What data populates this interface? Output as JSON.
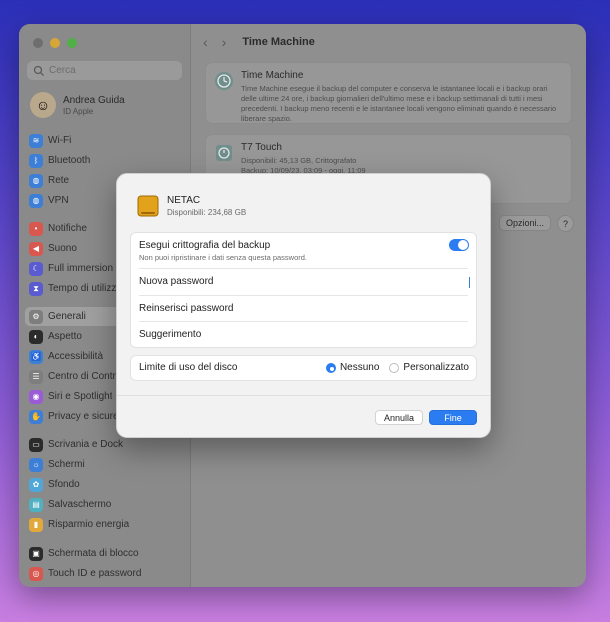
{
  "window": {
    "traffic_colors": [
      "#e14b43",
      "#e2a93a",
      "#56b847"
    ]
  },
  "sidebar": {
    "search_placeholder": "Cerca",
    "user": {
      "name": "Andrea Guida",
      "subtitle": "ID Apple"
    },
    "items": [
      {
        "label": "Wi-Fi",
        "icon": "wifi-icon",
        "color": "#3d7fd6"
      },
      {
        "label": "Bluetooth",
        "icon": "bluetooth-icon",
        "color": "#3d7fd6"
      },
      {
        "label": "Rete",
        "icon": "globe-icon",
        "color": "#3d7fd6"
      },
      {
        "label": "VPN",
        "icon": "vpn-icon",
        "color": "#3d7fd6"
      },
      {
        "label": "Notifiche",
        "icon": "bell-icon",
        "color": "#d8574e"
      },
      {
        "label": "Suono",
        "icon": "speaker-icon",
        "color": "#d8574e"
      },
      {
        "label": "Full immersion",
        "icon": "moon-icon",
        "color": "#5a5bd1"
      },
      {
        "label": "Tempo di utilizzo",
        "icon": "hourglass-icon",
        "color": "#5a5bd1"
      },
      {
        "label": "Generali",
        "icon": "gear-icon",
        "color": "#7e7e7e"
      },
      {
        "label": "Aspetto",
        "icon": "appearance-icon",
        "color": "#2b2b2b"
      },
      {
        "label": "Accessibilità",
        "icon": "accessibility-icon",
        "color": "#3d7fd6"
      },
      {
        "label": "Centro di Controllo",
        "icon": "control-center-icon",
        "color": "#7e7e7e"
      },
      {
        "label": "Siri e Spotlight",
        "icon": "siri-icon",
        "color": "#9b5bd6"
      },
      {
        "label": "Privacy e sicurezza",
        "icon": "hand-icon",
        "color": "#3d7fd6"
      },
      {
        "label": "Scrivania e Dock",
        "icon": "dock-icon",
        "color": "#2b2b2b"
      },
      {
        "label": "Schermi",
        "icon": "display-icon",
        "color": "#3d7fd6"
      },
      {
        "label": "Sfondo",
        "icon": "wallpaper-icon",
        "color": "#4fa6d8"
      },
      {
        "label": "Salvaschermo",
        "icon": "screensaver-icon",
        "color": "#4fb0c0"
      },
      {
        "label": "Risparmio energia",
        "icon": "battery-icon",
        "color": "#e2a93a"
      },
      {
        "label": "Schermata di blocco",
        "icon": "lock-screen-icon",
        "color": "#2b2b2b"
      },
      {
        "label": "Touch ID e password",
        "icon": "fingerprint-icon",
        "color": "#d8574e"
      }
    ]
  },
  "content": {
    "title": "Time Machine",
    "tm_card": {
      "title": "Time Machine",
      "description": "Time Machine esegue il backup del computer e conserva le istantanee locali e i backup orari delle ultime 24 ore, i backup giornalieri dell'ultimo mese e i backup settimanali di tutti i mesi precedenti. I backup meno recenti e le istantanee locali vengono eliminati quando è necessario liberare spazio."
    },
    "t7_card": {
      "title": "T7 Touch",
      "line1": "Disponibili: 45,13 GB, Crittografato",
      "line2": "Backup: 10/09/23, 03:09 - oggi, 11:09"
    },
    "options_label": "Opzioni...",
    "help_label": "?"
  },
  "dialog": {
    "drive_name": "NETAC",
    "drive_available": "Disponibili: 234,68 GB",
    "encrypt_label": "Esegui crittografia del backup",
    "encrypt_sub": "Non puoi ripristinare i dati senza questa password.",
    "encrypt_on": true,
    "new_password_placeholder": "Nuova password",
    "reenter_password_placeholder": "Reinserisci password",
    "hint_placeholder": "Suggerimento",
    "disk_limit_label": "Limite di uso del disco",
    "option_none": "Nessuno",
    "option_custom": "Personalizzato",
    "cancel_label": "Annulla",
    "done_label": "Fine",
    "accent_color": "#2a7cf0"
  }
}
